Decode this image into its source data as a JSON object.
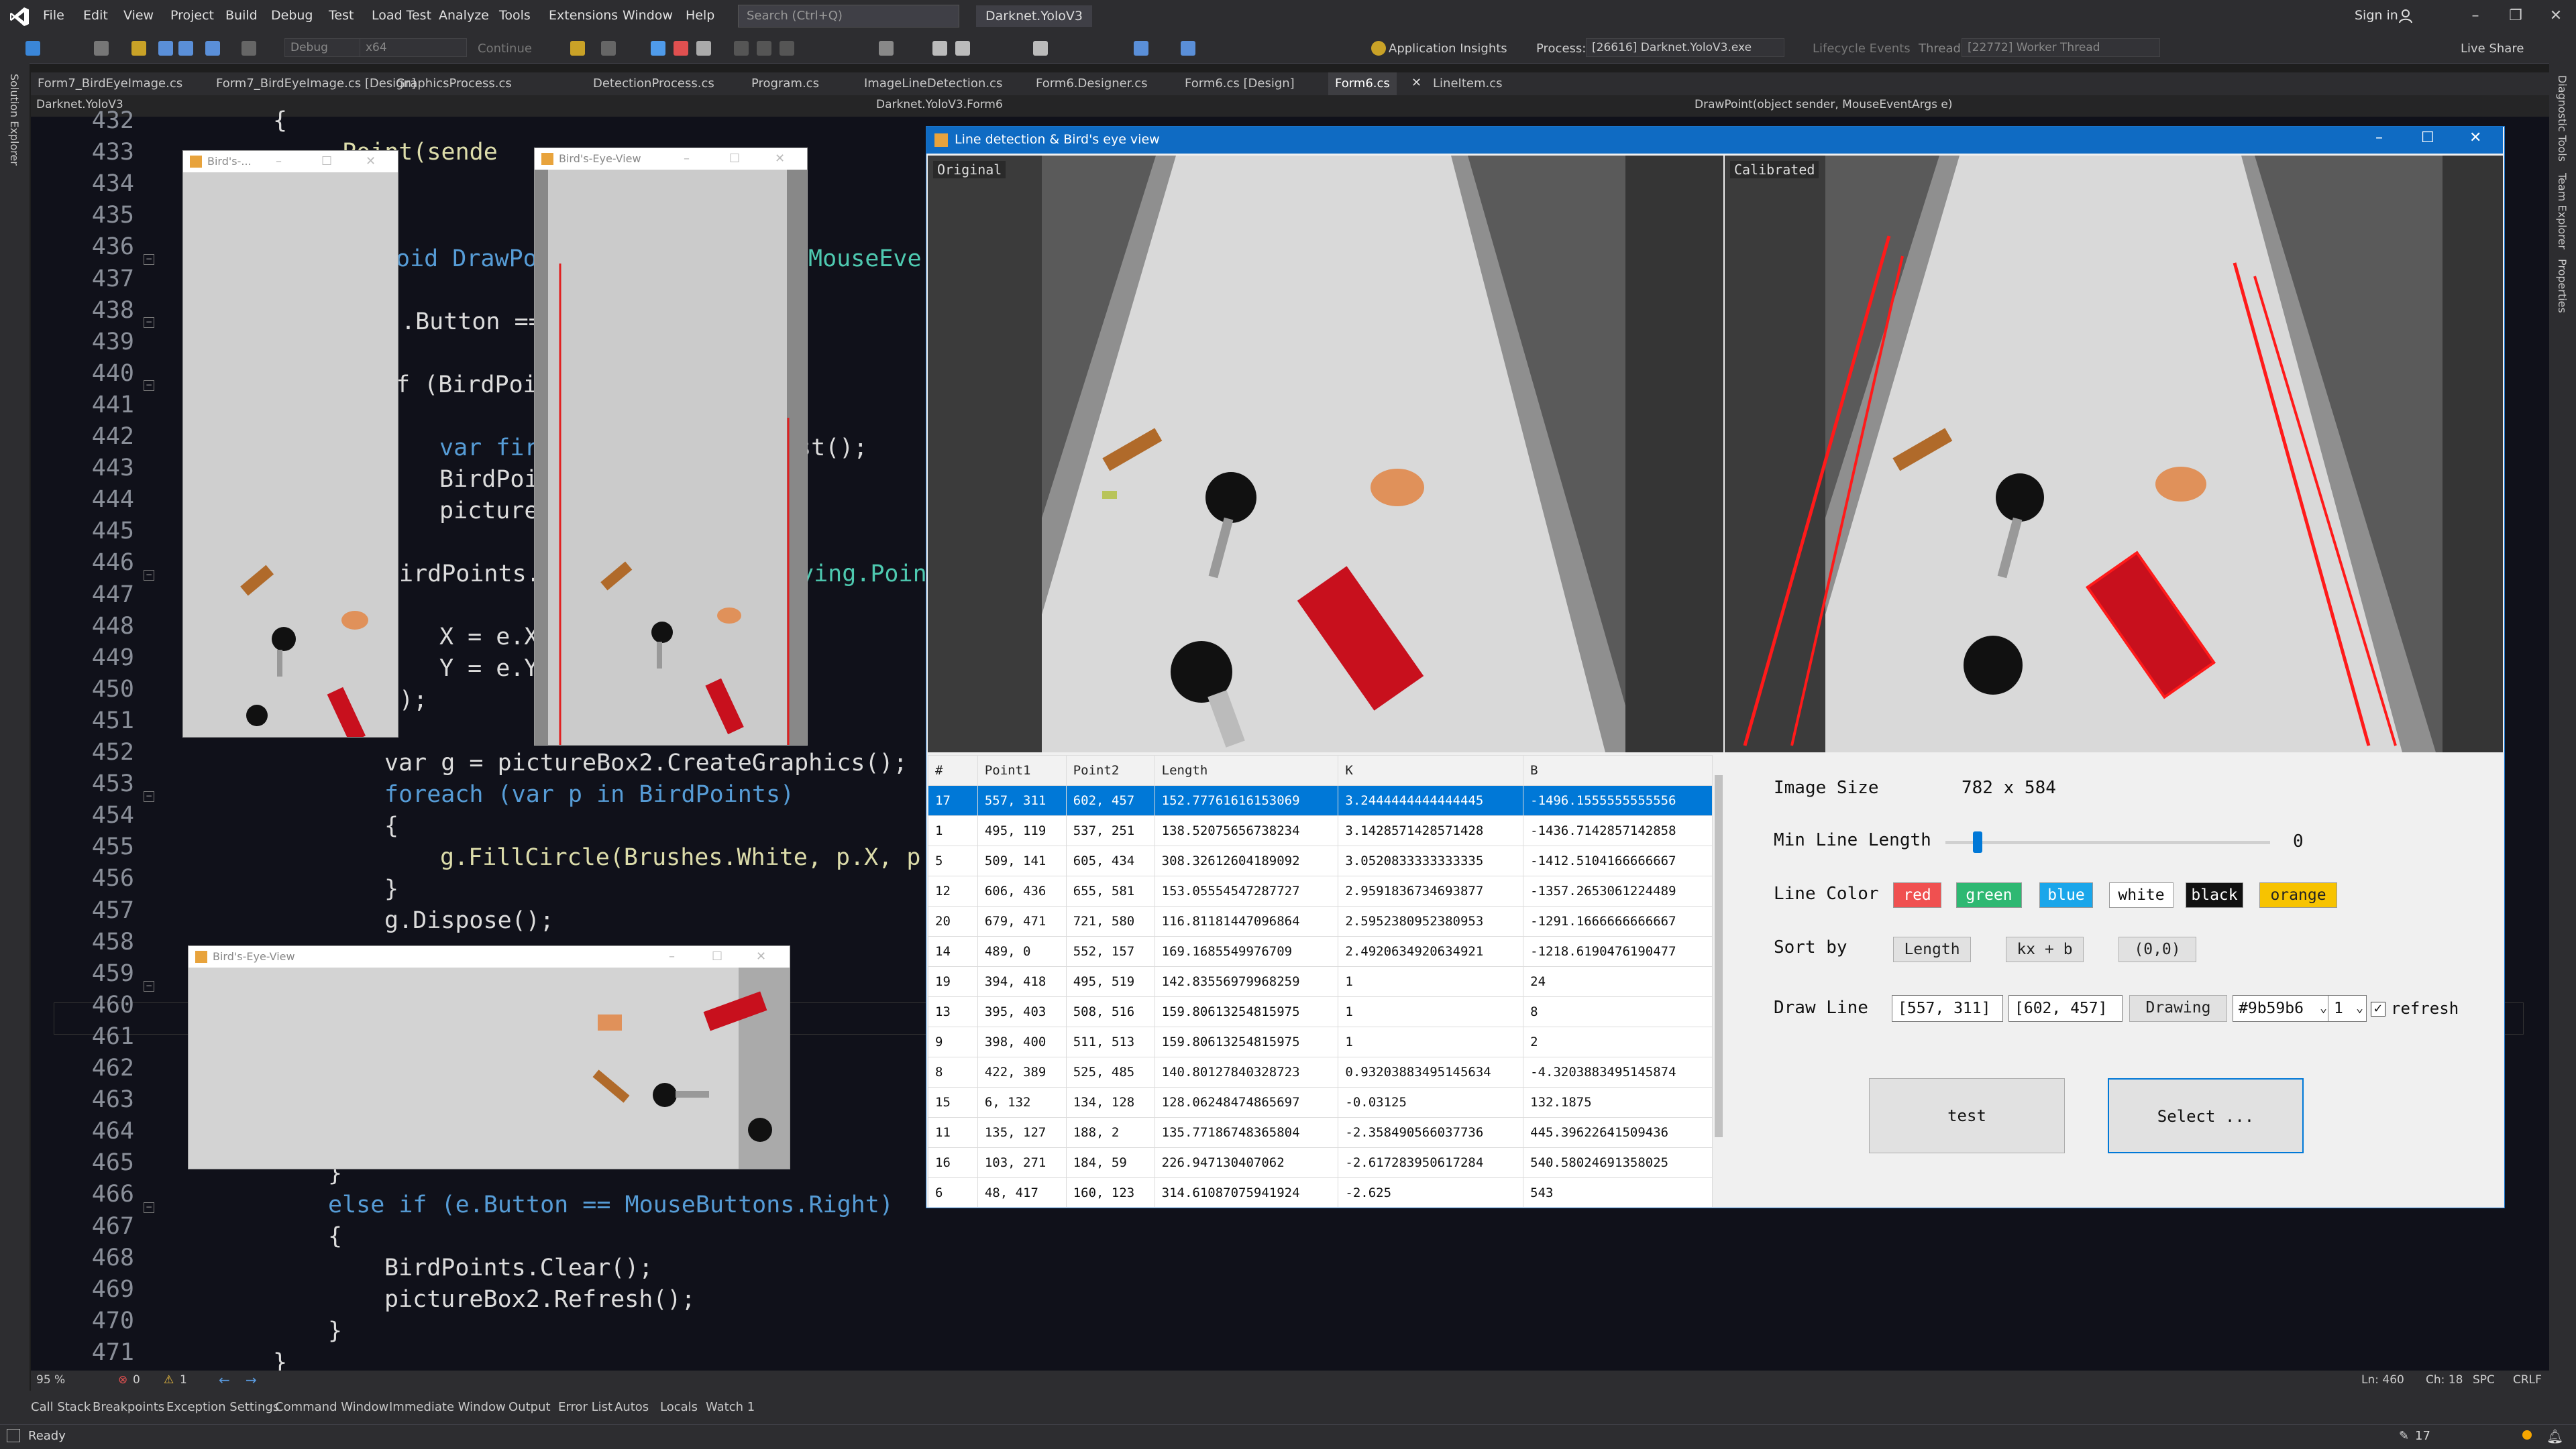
{
  "menu": [
    "File",
    "Edit",
    "View",
    "Project",
    "Build",
    "Debug",
    "Test",
    "Load Test",
    "Analyze",
    "Tools",
    "Extensions",
    "Window",
    "Help"
  ],
  "search_placeholder": "Search (Ctrl+Q)",
  "solution_name": "Darknet.YoloV3",
  "signin": "Sign in",
  "live_share": "Live Share",
  "toolbar": {
    "config": "Debug",
    "platform": "x64",
    "continue": "Continue",
    "app_insights": "Application Insights",
    "process_label": "Process:",
    "process": "[26616] Darknet.YoloV3.exe",
    "lifecycle": "Lifecycle Events",
    "thread_label": "Thread:",
    "thread": "[22772] Worker Thread"
  },
  "tabs": [
    "Form7_BirdEyeImage.cs",
    "Form7_BirdEyeImage.cs [Design]",
    "GraphicsProcess.cs",
    "DetectionProcess.cs",
    "Program.cs",
    "ImageLineDetection.cs",
    "Form6.Designer.cs",
    "Form6.cs [Design]",
    "Form6.cs",
    "LineItem.cs"
  ],
  "nav": {
    "project": "Darknet.YoloV3",
    "class": "Darknet.YoloV3.Form6",
    "member": "DrawPoint(object sender, MouseEventArgs e)"
  },
  "left_panel_label": "Solution Explorer",
  "right_panel_labels": [
    "Diagnostic Tools",
    "Team Explorer",
    "Properties"
  ],
  "code": {
    "line_numbers": [
      "432",
      "433",
      "434",
      "435",
      "436",
      "437",
      "438",
      "439",
      "440",
      "441",
      "442",
      "443",
      "444",
      "445",
      "446",
      "447",
      "448",
      "449",
      "450",
      "451",
      "452",
      "453",
      "454",
      "455",
      "456",
      "457",
      "458",
      "459",
      "460",
      "461",
      "462",
      "463",
      "464",
      "465",
      "466",
      "467",
      "468",
      "469",
      "470",
      "471"
    ],
    "frag_433": "Point(sende",
    "frag_436a": "oid DrawPo",
    "frag_436b": "MouseEve",
    "frag_438": ".Button ==",
    "frag_440": "f (BirdPoi",
    "frag_442a": "var fir",
    "frag_442b": "st();",
    "frag_443": "BirdPoi",
    "frag_444": "picture",
    "frag_446a": "irdPoints.",
    "frag_446b": "ying.Point",
    "frag_448": "X = e.X",
    "frag_449": "Y = e.Y",
    "frag_450": ");",
    "l452": "var g = pictureBox2.CreateGraphics();",
    "l453": "foreach (var p in BirdPoints)",
    "l454": "{",
    "l455": "g.FillCircle(Brushes.White, p.X, p",
    "l456": "}",
    "l457": "g.Dispose();",
    "l465": "}",
    "l466": "else if (e.Button == MouseButtons.Right)",
    "l467": "{",
    "l468": "BirdPoints.Clear();",
    "l469": "pictureBox2.Refresh();",
    "l470": "}",
    "l471": "}",
    "l432": "{"
  },
  "small_windows": [
    "Bird's-...",
    "Bird's-Eye-View",
    "Bird's-Eye-View"
  ],
  "main_window": {
    "title": "Line detection & Bird's eye view",
    "original_label": "Original",
    "calibrated_label": "Calibrated"
  },
  "grid": {
    "headers": [
      "#",
      "Point1",
      "Point2",
      "Length",
      "K",
      "B"
    ],
    "rows": [
      [
        "17",
        "557, 311",
        "602, 457",
        "152.77761616153069",
        "3.2444444444444445",
        "-1496.1555555555556"
      ],
      [
        "1",
        "495, 119",
        "537, 251",
        "138.52075656738234",
        "3.1428571428571428",
        "-1436.7142857142858"
      ],
      [
        "5",
        "509, 141",
        "605, 434",
        "308.32612604189092",
        "3.0520833333333335",
        "-1412.5104166666667"
      ],
      [
        "12",
        "606, 436",
        "655, 581",
        "153.05554547287727",
        "2.9591836734693877",
        "-1357.2653061224489"
      ],
      [
        "20",
        "679, 471",
        "721, 580",
        "116.81181447096864",
        "2.5952380952380953",
        "-1291.1666666666667"
      ],
      [
        "14",
        "489, 0",
        "552, 157",
        "169.1685549976709",
        "2.4920634920634921",
        "-1218.6190476190477"
      ],
      [
        "19",
        "394, 418",
        "495, 519",
        "142.83556979968259",
        "1",
        "24"
      ],
      [
        "13",
        "395, 403",
        "508, 516",
        "159.80613254815975",
        "1",
        "8"
      ],
      [
        "9",
        "398, 400",
        "511, 513",
        "159.80613254815975",
        "1",
        "2"
      ],
      [
        "8",
        "422, 389",
        "525, 485",
        "140.80127840328723",
        "0.93203883495145634",
        "-4.3203883495145874"
      ],
      [
        "15",
        "6, 132",
        "134, 128",
        "128.06248474865697",
        "-0.03125",
        "132.1875"
      ],
      [
        "11",
        "135, 127",
        "188, 2",
        "135.77186748365804",
        "-2.358490566037736",
        "445.39622641509436"
      ],
      [
        "16",
        "103, 271",
        "184, 59",
        "226.947130407062",
        "-2.617283950617284",
        "540.58024691358025"
      ],
      [
        "6",
        "48, 417",
        "160, 123",
        "314.61087075941924",
        "-2.625",
        "543"
      ]
    ]
  },
  "panel": {
    "image_size_label": "Image Size",
    "image_size_value": "782 x 584",
    "min_len_label": "Min Line Length",
    "min_len_value": "0",
    "min_len_fraction": 0.1,
    "line_color_label": "Line Color",
    "colors": [
      {
        "name": "red",
        "bg": "#f05050",
        "fg": "#ffffff"
      },
      {
        "name": "green",
        "bg": "#2eb872",
        "fg": "#ffffff"
      },
      {
        "name": "blue",
        "bg": "#1aa6ea",
        "fg": "#ffffff"
      },
      {
        "name": "white",
        "bg": "#ffffff",
        "fg": "#111111"
      },
      {
        "name": "black",
        "bg": "#111111",
        "fg": "#ffffff"
      },
      {
        "name": "orange",
        "bg": "#f7c300",
        "fg": "#222222"
      }
    ],
    "sort_label": "Sort by",
    "sort_buttons": [
      "Length",
      "kx + b",
      "(0,0)"
    ],
    "draw_line_label": "Draw Line",
    "point1": "[557, 311]",
    "point2": "[602, 457]",
    "drawing": "Drawing",
    "color_value": "#9b59b6",
    "width_value": "1",
    "refresh_label": "refresh",
    "refresh_checked": true,
    "test_button": "test",
    "select_button": "Select ..."
  },
  "editor_footer": {
    "zoom": "95 %",
    "errors": "0",
    "warnings": "1",
    "ln": "Ln: 460",
    "ch": "Ch: 18",
    "spc": "SPC",
    "crlf": "CRLF"
  },
  "tool_tabs": [
    "Call Stack",
    "Breakpoints",
    "Exception Settings",
    "Command Window",
    "Immediate Window",
    "Output",
    "Error List",
    "Autos",
    "Locals",
    "Watch 1"
  ],
  "status": {
    "ready": "Ready",
    "count": "17"
  },
  "accent": "#0078d7"
}
